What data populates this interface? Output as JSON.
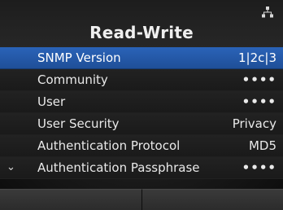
{
  "header": {
    "title": "Read-Write",
    "status_icon": "network-icon"
  },
  "menu": {
    "items": [
      {
        "label": "SNMP Version",
        "value": "1|2c|3",
        "selected": true
      },
      {
        "label": "Community",
        "value": "••••",
        "selected": false
      },
      {
        "label": "User",
        "value": "••••",
        "selected": false
      },
      {
        "label": "User Security",
        "value": "Privacy",
        "selected": false
      },
      {
        "label": "Authentication Protocol",
        "value": "MD5",
        "selected": false
      },
      {
        "label": "Authentication Passphrase",
        "value": "••••",
        "selected": false,
        "indicator": "›"
      }
    ]
  },
  "colors": {
    "selection": "#2a63b8",
    "background": "#1a1a1a",
    "text": "#e9e9e9"
  }
}
